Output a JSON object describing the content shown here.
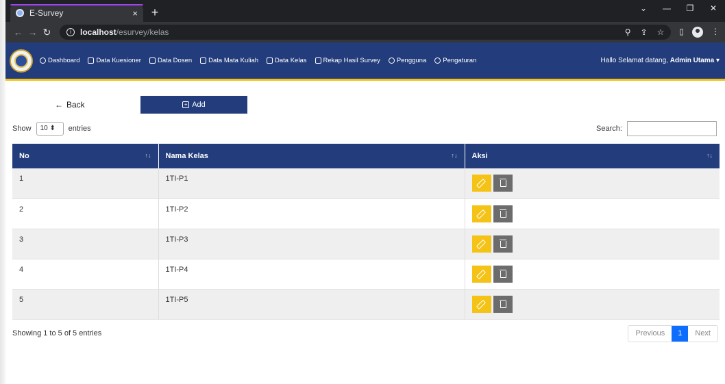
{
  "browser": {
    "tab_title": "E-Survey",
    "tab_close": "×",
    "new_tab": "+",
    "url_host": "localhost",
    "url_path": "/esurvey/kelas",
    "win_min": "—",
    "win_max": "❐",
    "win_close": "✕",
    "chevron": "⌄"
  },
  "navbar": {
    "menu": [
      {
        "label": "Dashboard",
        "icon": "dashboard-icon"
      },
      {
        "label": "Data Kuesioner",
        "icon": "document-icon"
      },
      {
        "label": "Data Dosen",
        "icon": "users-icon"
      },
      {
        "label": "Data Mata Kuliah",
        "icon": "document-icon"
      },
      {
        "label": "Data Kelas",
        "icon": "home-icon"
      },
      {
        "label": "Rekap Hasil Survey",
        "icon": "document-icon"
      },
      {
        "label": "Pengguna",
        "icon": "user-circle-icon"
      },
      {
        "label": "Pengaturan",
        "icon": "gear-icon"
      }
    ],
    "greeting": "Hallo Selamat datang,",
    "user": "Admin Utama",
    "caret": "▾"
  },
  "actions": {
    "back_label": "Back",
    "add_label": "Add"
  },
  "datatable": {
    "show_label": "Show",
    "entries_label": "entries",
    "page_length": "10",
    "search_label": "Search:",
    "columns": [
      "No",
      "Nama Kelas",
      "Aksi"
    ],
    "rows": [
      {
        "no": "1",
        "nama": "1TI-P1"
      },
      {
        "no": "2",
        "nama": "1TI-P2"
      },
      {
        "no": "3",
        "nama": "1TI-P3"
      },
      {
        "no": "4",
        "nama": "1TI-P4"
      },
      {
        "no": "5",
        "nama": "1TI-P5"
      }
    ],
    "info": "Showing 1 to 5 of 5 entries",
    "previous": "Previous",
    "current_page": "1",
    "next": "Next"
  },
  "colors": {
    "primary": "#233d7c",
    "accent": "#f5c316",
    "delete": "#6c6c6c",
    "page_active": "#0d6efd"
  }
}
